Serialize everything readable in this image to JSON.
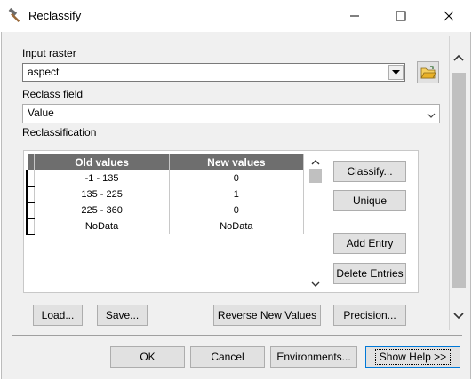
{
  "window": {
    "title": "Reclassify",
    "icon": "hammer-icon"
  },
  "input_raster": {
    "label": "Input raster",
    "value": "aspect"
  },
  "reclass_field": {
    "label": "Reclass field",
    "value": "Value"
  },
  "reclassification": {
    "label": "Reclassification",
    "columns": [
      "Old values",
      "New values"
    ],
    "rows": [
      {
        "old": "-1 - 135",
        "new": "0"
      },
      {
        "old": "135 - 225",
        "new": "1"
      },
      {
        "old": "225 - 360",
        "new": "0"
      },
      {
        "old": "NoData",
        "new": "NoData"
      }
    ]
  },
  "side_buttons": {
    "classify": "Classify...",
    "unique": "Unique",
    "add_entry": "Add Entry",
    "delete_entries": "Delete Entries"
  },
  "bottom_buttons": {
    "load": "Load...",
    "save": "Save...",
    "reverse": "Reverse New Values",
    "precision": "Precision..."
  },
  "footer_buttons": {
    "ok": "OK",
    "cancel": "Cancel",
    "environments": "Environments...",
    "show_help": "Show Help >>"
  },
  "colors": {
    "header_bg": "#6e6e6e",
    "folder_accent": "#e8b028"
  }
}
